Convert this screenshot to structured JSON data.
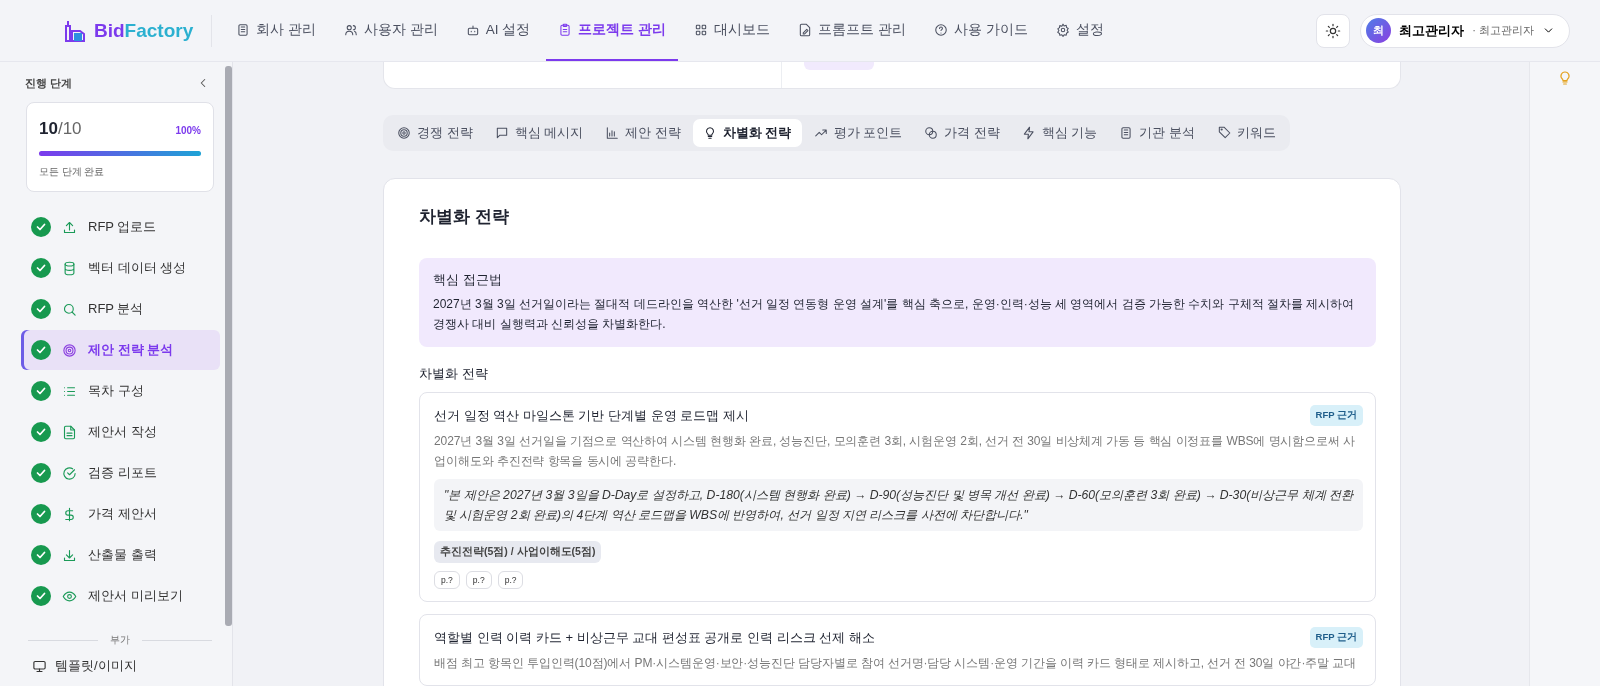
{
  "header": {
    "logo": {
      "part_1": "Bid",
      "part_2": "Factory"
    },
    "nav": [
      {
        "label": "회사 관리",
        "selected": false
      },
      {
        "label": "사용자 관리",
        "selected": false
      },
      {
        "label": "AI 설정",
        "selected": false
      },
      {
        "label": "프로젝트 관리",
        "selected": true
      },
      {
        "label": "대시보드",
        "selected": false
      },
      {
        "label": "프롬프트 관리",
        "selected": false
      },
      {
        "label": "사용 가이드",
        "selected": false
      },
      {
        "label": "설정",
        "selected": false
      }
    ],
    "user": {
      "avatar": "최",
      "name": "최고관리자",
      "role": "· 최고관리자"
    }
  },
  "sidebar": {
    "title": "진행 단계",
    "progress": {
      "done": "10",
      "separator": "/",
      "total": "10",
      "percent": "100%",
      "level": 1,
      "caption": "모든 단계 완료"
    },
    "steps": [
      {
        "label": "RFP 업로드",
        "done": true,
        "selected": false
      },
      {
        "label": "벡터 데이터 생성",
        "done": true,
        "selected": false
      },
      {
        "label": "RFP 분석",
        "done": true,
        "selected": false
      },
      {
        "label": "제안 전략 분석",
        "done": true,
        "selected": true
      },
      {
        "label": "목차 구성",
        "done": true,
        "selected": false
      },
      {
        "label": "제안서 작성",
        "done": true,
        "selected": false
      },
      {
        "label": "검증 리포트",
        "done": true,
        "selected": false
      },
      {
        "label": "가격 제안서",
        "done": true,
        "selected": false
      },
      {
        "label": "산출물 출력",
        "done": true,
        "selected": false
      },
      {
        "label": "제안서 미리보기",
        "done": true,
        "selected": false
      }
    ],
    "section_label": "부가",
    "extra_items": [
      {
        "label": "템플릿/이미지"
      }
    ]
  },
  "tabs": [
    {
      "label": "경쟁 전략",
      "selected": false
    },
    {
      "label": "핵심 메시지",
      "selected": false
    },
    {
      "label": "제안 전략",
      "selected": false
    },
    {
      "label": "차별화 전략",
      "selected": true
    },
    {
      "label": "평가 포인트",
      "selected": false
    },
    {
      "label": "가격 전략",
      "selected": false
    },
    {
      "label": "핵심 기능",
      "selected": false
    },
    {
      "label": "기관 분석",
      "selected": false
    },
    {
      "label": "키워드",
      "selected": false
    }
  ],
  "content": {
    "title": "차별화 전략",
    "approach": {
      "title": "핵심 접근법",
      "text": "2027년 3월 3일 선거일이라는 절대적 데드라인을 역산한 '선거 일정 연동형 운영 설계'를 핵심 축으로, 운영·인력·성능 세 영역에서 검증 가능한 수치와 구체적 절차를 제시하여 경쟁사 대비 실행력과 신뢰성을 차별화한다."
    },
    "section_title": "차별화 전략",
    "strategies": [
      {
        "title": "선거 일정 역산 마일스톤 기반 단계별 운영 로드맵 제시",
        "badge": "RFP 근거",
        "description": "2027년 3월 3일 선거일을 기점으로 역산하여 시스템 현행화 완료, 성능진단, 모의훈련 3회, 시험운영 2회, 선거 전 30일 비상체계 가동 등 핵심 이정표를 WBS에 명시함으로써 사업이해도와 추진전략 항목을 동시에 공략한다.",
        "quote": "\"본 제안은 2027년 3월 3일을 D-Day로 설정하고, D-180(시스템 현행화 완료) → D-90(성능진단 및 병목 개선 완료) → D-60(모의훈련 3회 완료) → D-30(비상근무 체계 전환 및 시험운영 2회 완료)의 4단계 역산 로드맵을 WBS에 반영하여, 선거 일정 지연 리스크를 사전에 차단합니다.\"",
        "tag": "추진전략(5점) / 사업이해도(5점)",
        "refs": [
          "p.?",
          "p.?",
          "p.?"
        ]
      },
      {
        "title": "역할별 인력 이력 카드 + 비상근무 교대 편성표 공개로 인력 리스크 선제 해소",
        "badge": "RFP 근거",
        "description": "배점 최고 항목인 투입인력(10점)에서 PM·시스템운영·보안·성능진단 담당자별로 참여 선거명·담당 시스템·운영 기간을 이력 카드 형태로 제시하고, 선거 전 30일 야간·주말 교대"
      }
    ]
  }
}
